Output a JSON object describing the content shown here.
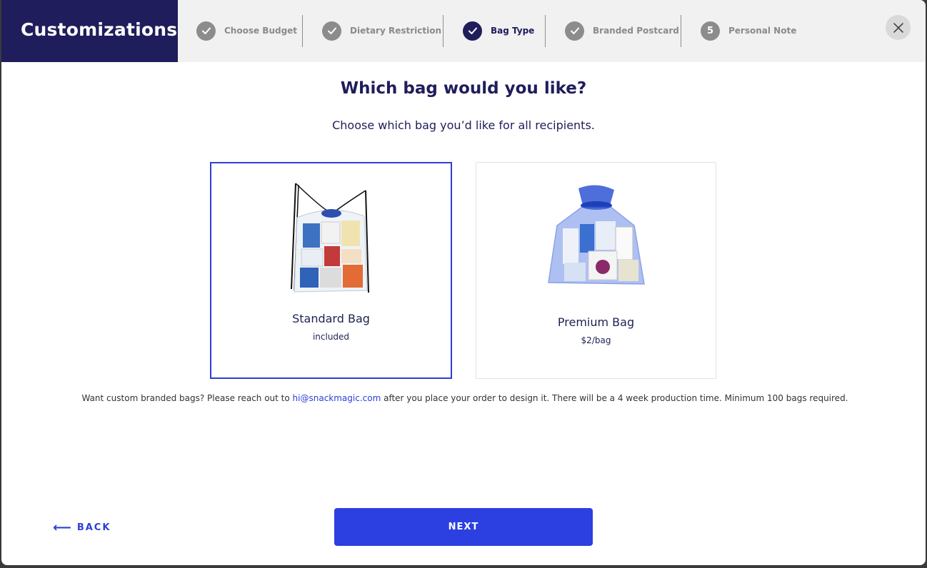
{
  "header": {
    "brand": "Customizations",
    "steps": [
      {
        "label": "Choose Budget",
        "state": "done"
      },
      {
        "label": "Dietary Restriction",
        "state": "done"
      },
      {
        "label": "Bag Type",
        "state": "active"
      },
      {
        "label": "Branded Postcard",
        "state": "done"
      },
      {
        "label": "Personal Note",
        "state": "pending",
        "number": "5"
      }
    ],
    "close_icon": "close-icon"
  },
  "main": {
    "title": "Which bag would you like?",
    "subtitle": "Choose which bag you’d like for all recipients.",
    "options": [
      {
        "name": "Standard Bag",
        "price": "included",
        "selected": true
      },
      {
        "name": "Premium Bag",
        "price": "$2/bag",
        "selected": false
      }
    ],
    "note_before": "Want custom branded bags? Please reach out to ",
    "note_email": "hi@snackmagic.com",
    "note_after": " after you place your order to design it. There will be a 4 week production time. Minimum 100 bags required."
  },
  "footer": {
    "back_label": "BACK",
    "back_arrow": "⟵",
    "next_label": "NEXT"
  },
  "colors": {
    "brand_navy": "#1f1d5b",
    "accent_blue": "#2c3fe0",
    "step_gray": "#8c8c8c"
  }
}
